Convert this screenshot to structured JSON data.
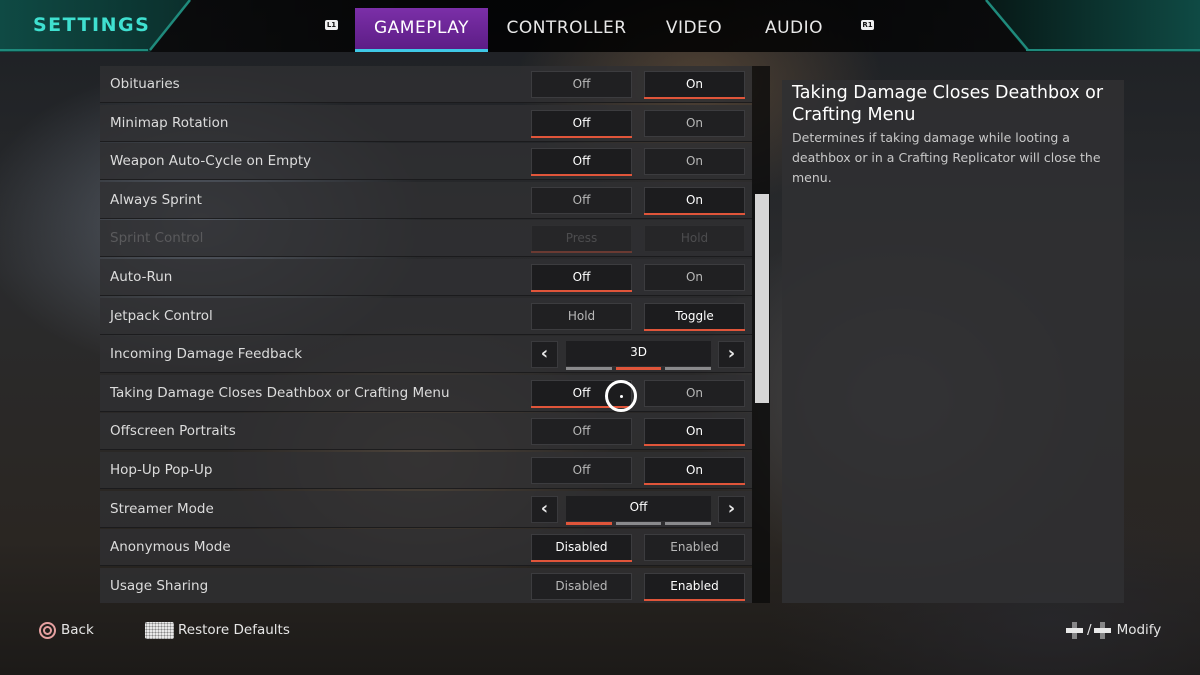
{
  "header": {
    "title": "SETTINGS",
    "left_bumper": "L1",
    "right_bumper": "R1",
    "tabs": [
      {
        "label": "GAMEPLAY",
        "active": true
      },
      {
        "label": "CONTROLLER",
        "active": false
      },
      {
        "label": "VIDEO",
        "active": false
      },
      {
        "label": "AUDIO",
        "active": false
      }
    ]
  },
  "settings": [
    {
      "label": "Obituaries",
      "type": "toggle",
      "options": [
        "Off",
        "On"
      ],
      "selected": 1,
      "enabled": true
    },
    {
      "label": "Minimap Rotation",
      "type": "toggle",
      "options": [
        "Off",
        "On"
      ],
      "selected": 0,
      "enabled": true
    },
    {
      "label": "Weapon Auto-Cycle on Empty",
      "type": "toggle",
      "options": [
        "Off",
        "On"
      ],
      "selected": 0,
      "enabled": true
    },
    {
      "label": "Always Sprint",
      "type": "toggle",
      "options": [
        "Off",
        "On"
      ],
      "selected": 1,
      "enabled": true
    },
    {
      "label": "Sprint Control",
      "type": "toggle",
      "options": [
        "Press",
        "Hold"
      ],
      "selected": 0,
      "enabled": false
    },
    {
      "label": "Auto-Run",
      "type": "toggle",
      "options": [
        "Off",
        "On"
      ],
      "selected": 0,
      "enabled": true
    },
    {
      "label": "Jetpack Control",
      "type": "toggle",
      "options": [
        "Hold",
        "Toggle"
      ],
      "selected": 1,
      "enabled": true
    },
    {
      "label": "Incoming Damage Feedback",
      "type": "cycle",
      "value": "3D",
      "option_count": 3,
      "selected": 1,
      "enabled": true
    },
    {
      "label": "Taking Damage Closes Deathbox or Crafting Menu",
      "type": "toggle",
      "options": [
        "Off",
        "On"
      ],
      "selected": 0,
      "enabled": true,
      "focused": true
    },
    {
      "label": "Offscreen Portraits",
      "type": "toggle",
      "options": [
        "Off",
        "On"
      ],
      "selected": 1,
      "enabled": true
    },
    {
      "label": "Hop-Up Pop-Up",
      "type": "toggle",
      "options": [
        "Off",
        "On"
      ],
      "selected": 1,
      "enabled": true
    },
    {
      "label": "Streamer Mode",
      "type": "cycle",
      "value": "Off",
      "option_count": 3,
      "selected": 0,
      "enabled": true
    },
    {
      "label": "Anonymous Mode",
      "type": "toggle",
      "options": [
        "Disabled",
        "Enabled"
      ],
      "selected": 0,
      "enabled": true
    },
    {
      "label": "Usage Sharing",
      "type": "toggle",
      "options": [
        "Disabled",
        "Enabled"
      ],
      "selected": 1,
      "enabled": true
    }
  ],
  "description": {
    "title": "Taking Damage Closes Deathbox or Crafting Menu",
    "body": "Determines if taking damage while looting a deathbox or in a Crafting Replicator will close the menu."
  },
  "footer": {
    "back_label": "Back",
    "restore_label": "Restore Defaults",
    "modify_label": "Modify",
    "modify_separator": "/"
  },
  "colors": {
    "accent_teal": "#3fe0d0",
    "active_tab": "#7b2fa8",
    "tab_underline": "#3fc8e6",
    "selection_underline": "#e0553a"
  }
}
